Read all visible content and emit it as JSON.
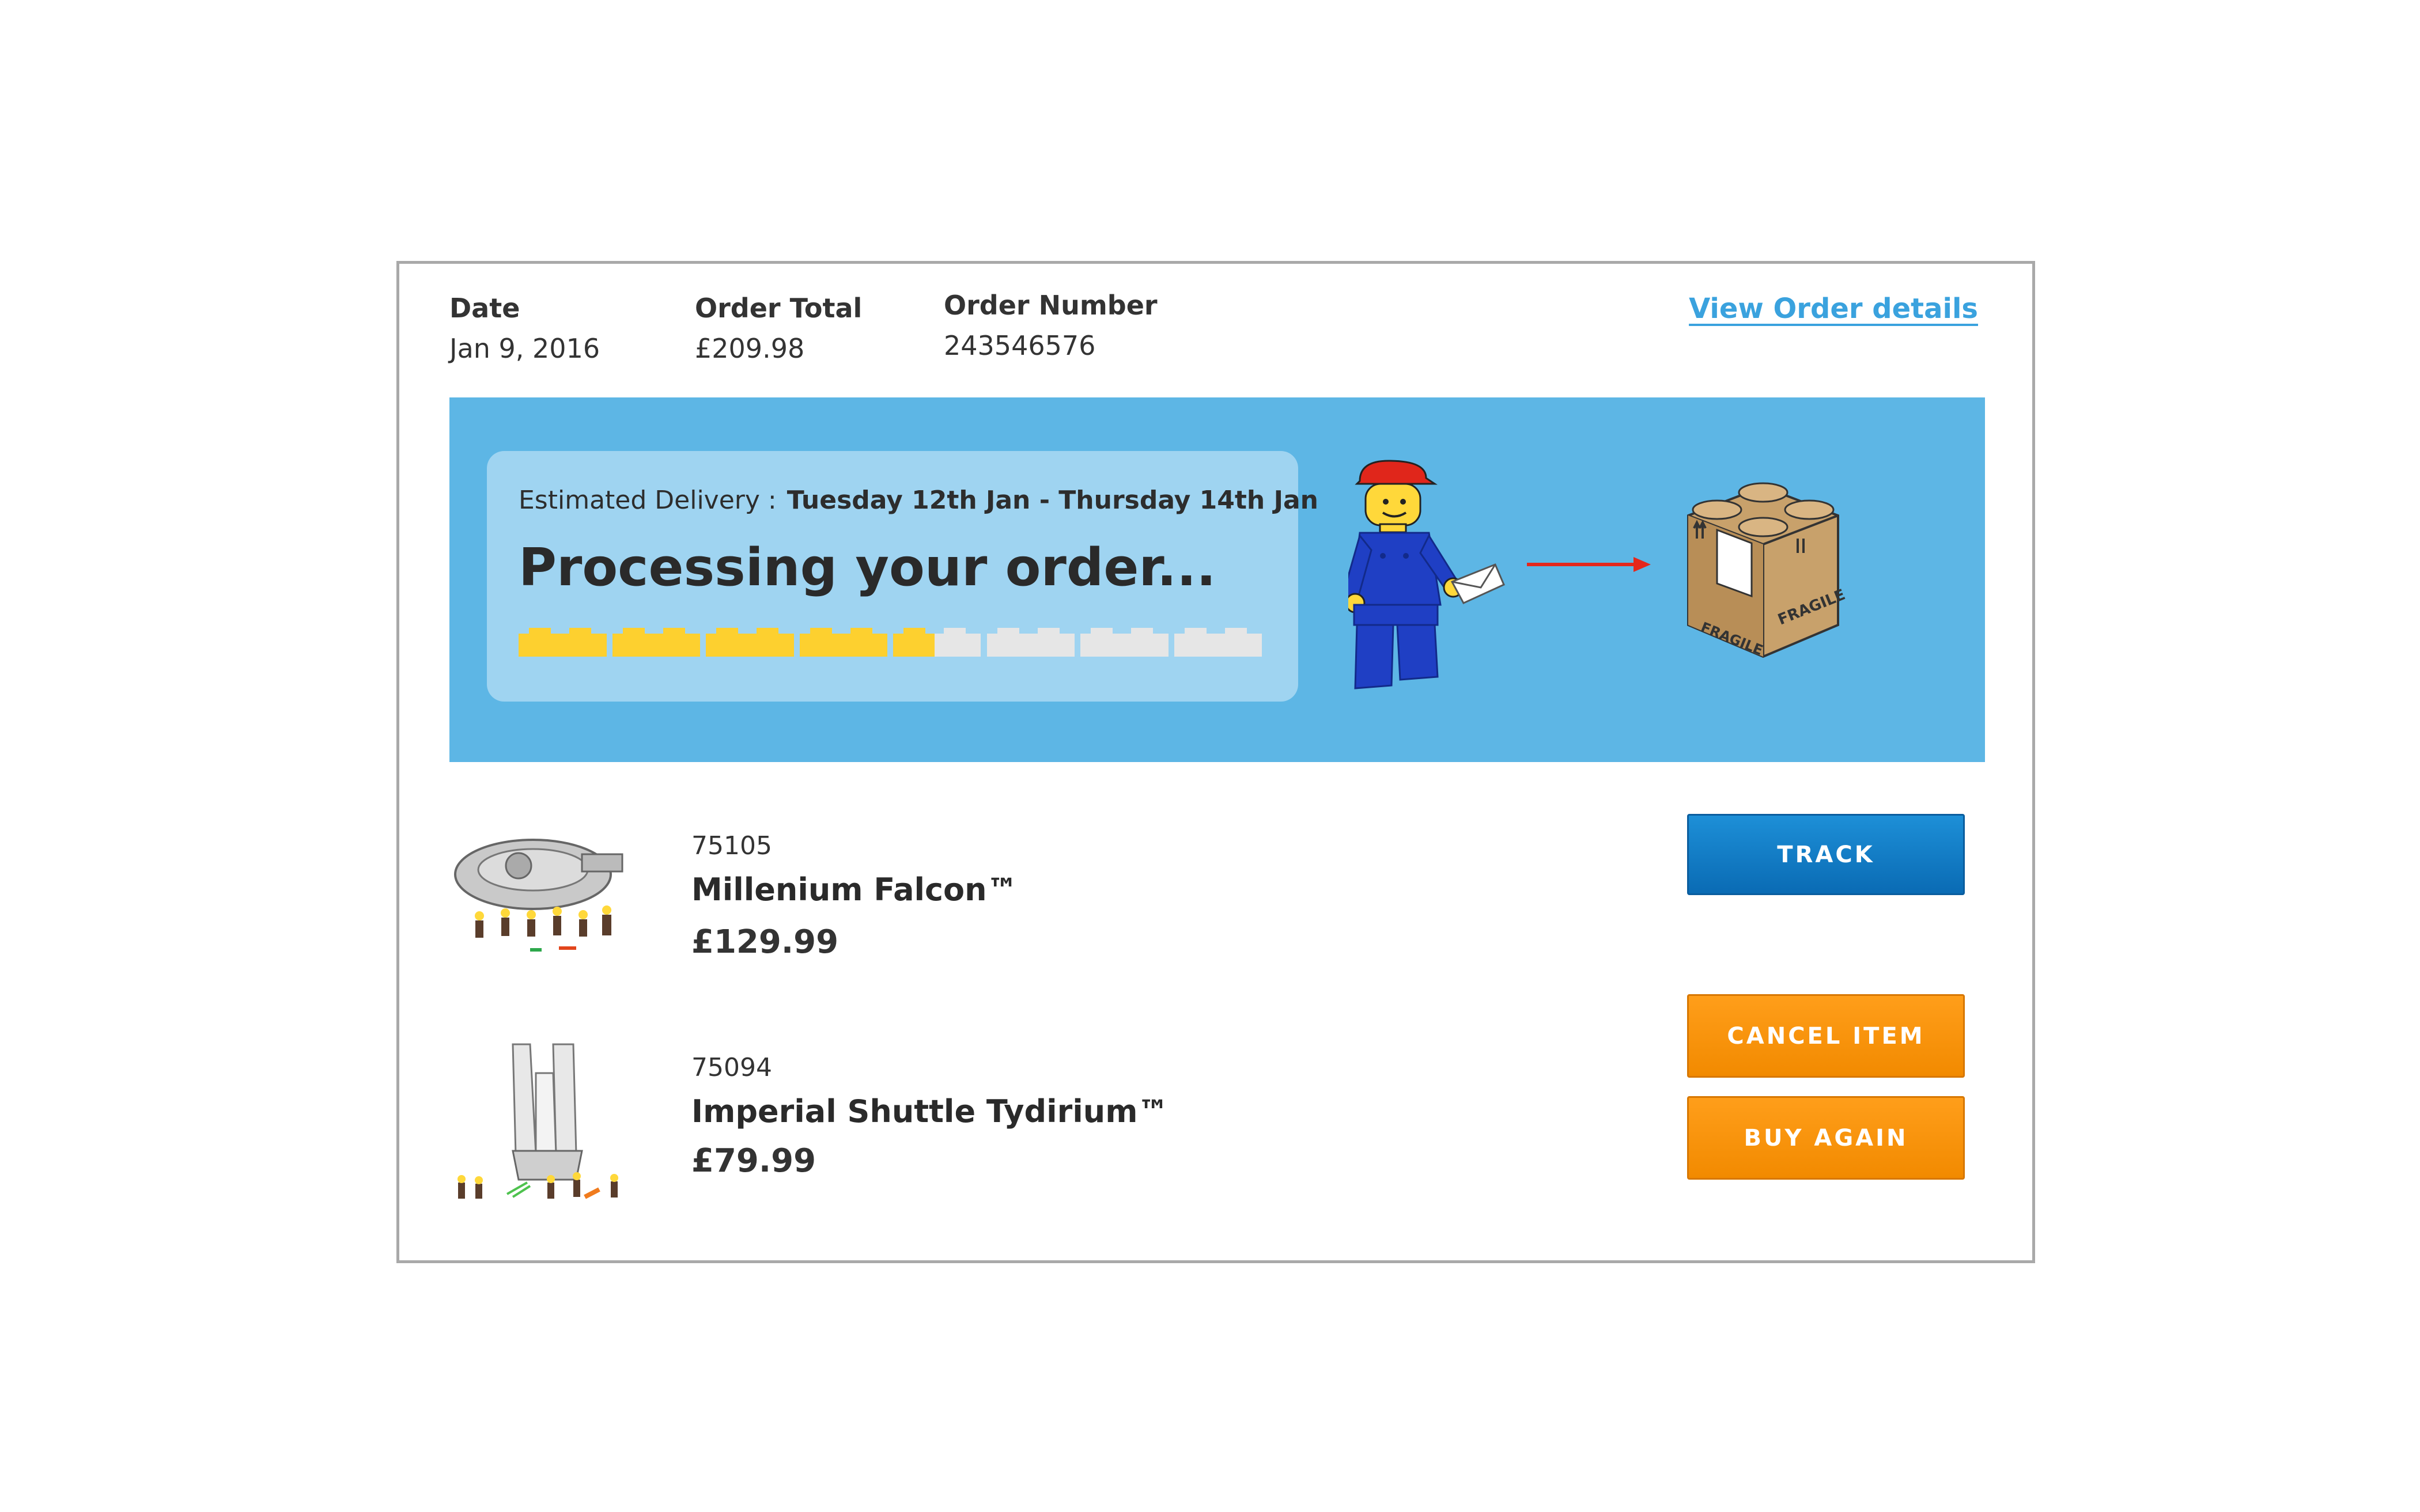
{
  "order": {
    "date_label": "Date",
    "date_value": "Jan 9, 2016",
    "total_label": "Order Total",
    "total_value": "£209.98",
    "number_label": "Order Number",
    "number_value": "243546576",
    "view_details": "View Order details"
  },
  "status": {
    "estimated_label": "Estimated Delivery :",
    "estimated_value": "Tuesday 12th Jan - Thursday 14th Jan",
    "heading": "Processing your order...",
    "progress_fraction": 0.56,
    "progress_segments": 8
  },
  "colors": {
    "banner": "#5db6e5",
    "status_box": "#9fd4f1",
    "progress_filled": "#fdd02f",
    "progress_empty": "#e6e6e6",
    "track_button": "#0a7bc6",
    "orange_button": "#f79012",
    "link": "#3aa2de"
  },
  "illustration": {
    "box_label_1": "FRAGILE",
    "box_label_2": "FRAGILE"
  },
  "products": [
    {
      "sku": "75105",
      "name": "Millenium Falcon™",
      "price": "£129.99",
      "icon": "millennium-falcon-set-image"
    },
    {
      "sku": "75094",
      "name": "Imperial Shuttle Tydirium™",
      "price": "£79.99",
      "icon": "imperial-shuttle-set-image"
    }
  ],
  "buttons": {
    "track": "TRACK",
    "cancel": "CANCEL ITEM",
    "buy_again": "BUY AGAIN"
  }
}
